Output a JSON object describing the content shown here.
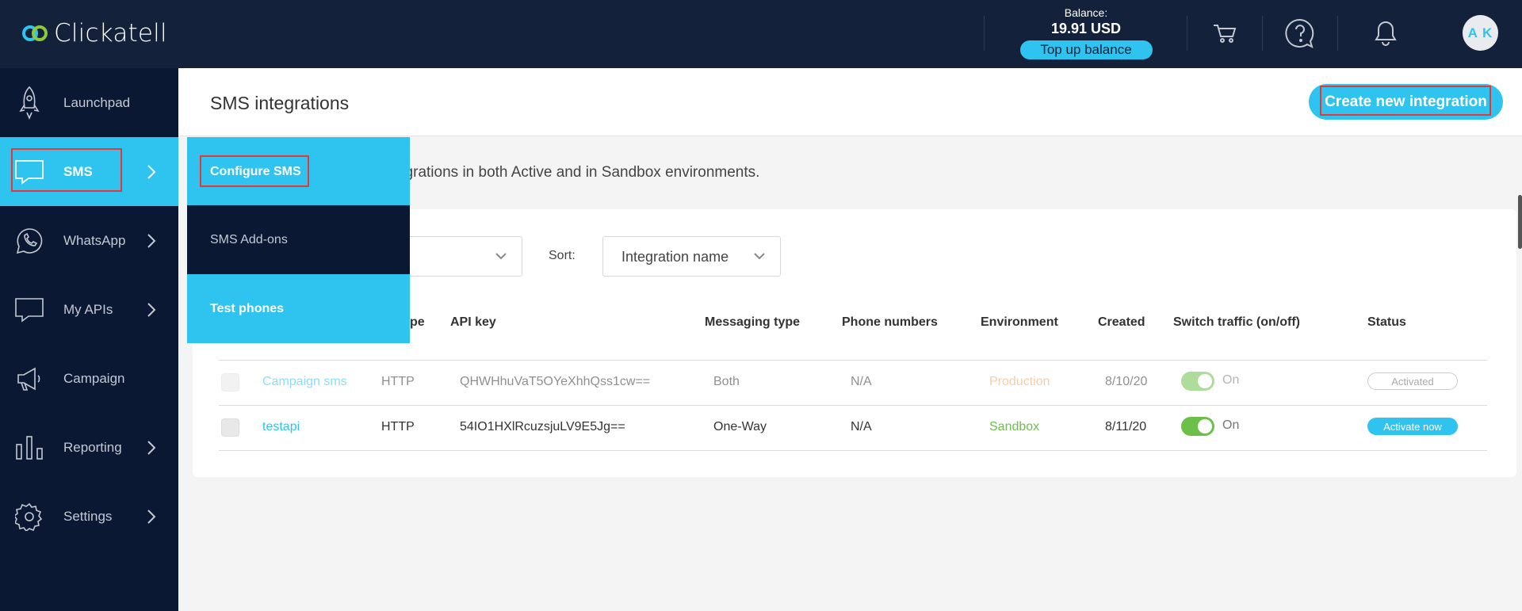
{
  "app": {
    "name": "Clickatell"
  },
  "header": {
    "balance_label": "Balance:",
    "balance_amount": "19.91 USD",
    "topup_label": "Top up balance",
    "avatar_initials": "A K"
  },
  "sidebar": {
    "items": [
      {
        "label": "Launchpad"
      },
      {
        "label": "SMS"
      },
      {
        "label": "WhatsApp"
      },
      {
        "label": "My APIs"
      },
      {
        "label": "Campaign"
      },
      {
        "label": "Reporting"
      },
      {
        "label": "Settings"
      }
    ]
  },
  "submenu": {
    "items": [
      {
        "label": "Configure SMS"
      },
      {
        "label": "SMS Add-ons"
      },
      {
        "label": "Test phones"
      }
    ]
  },
  "main": {
    "title": "SMS integrations",
    "create_label": "Create new integration",
    "description": "egrations in both Active and in Sandbox environments.",
    "sort_label": "Sort:",
    "sort_value": "Integration name"
  },
  "table": {
    "headers": {
      "type": "pe",
      "api_key": "API key",
      "messaging": "Messaging type",
      "phones": "Phone numbers",
      "env": "Environment",
      "created": "Created",
      "switch": "Switch traffic (on/off)",
      "status": "Status"
    },
    "rows": [
      {
        "name": "Campaign sms",
        "type": "HTTP",
        "api_key": "QHWHhuVaT5OYeXhhQss1cw==",
        "messaging": "Both",
        "phones": "N/A",
        "env": "Production",
        "created": "8/10/20",
        "switch": "On",
        "status": "Activated"
      },
      {
        "name": "testapi",
        "type": "HTTP",
        "api_key": "54IO1HXlRcuzsjuLV9E5Jg==",
        "messaging": "One-Way",
        "phones": "N/A",
        "env": "Sandbox",
        "created": "8/11/20",
        "switch": "On",
        "status": "Activate now"
      }
    ]
  },
  "colors": {
    "topbar": "#13213b",
    "sidebar": "#0b1834",
    "accent": "#2ec4ef",
    "production": "#f0a465",
    "sandbox": "#6cc04a",
    "highlight_box": "#e53935"
  }
}
